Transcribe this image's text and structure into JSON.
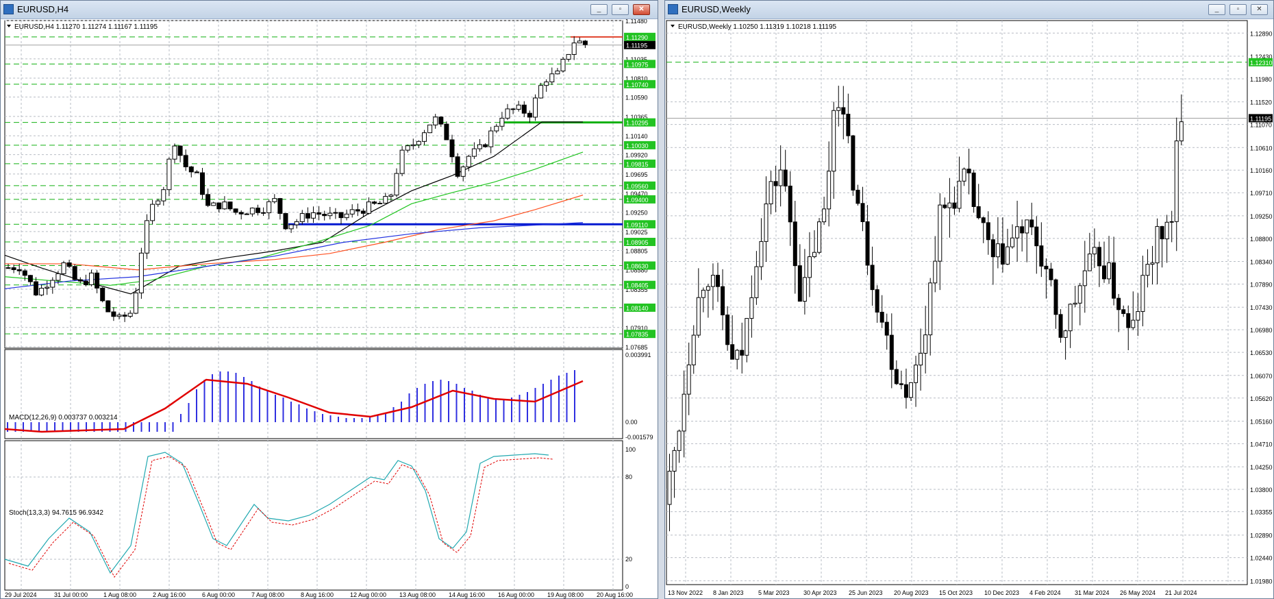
{
  "left_window": {
    "title": "EURUSD,H4",
    "chart_header": "EURUSD,H4  1.11270 1.11274 1.11167 1.11195",
    "price_labels": [
      "1.11480",
      "1.11035",
      "1.10810",
      "1.10590",
      "1.10365",
      "1.10140",
      "1.09920",
      "1.09695",
      "1.09470",
      "1.09250",
      "1.09025",
      "1.08805",
      "1.08580",
      "1.08355",
      "1.07910",
      "1.07685"
    ],
    "level_labels": [
      "1.11290",
      "1.10975",
      "1.10740",
      "1.10295",
      "1.10030",
      "1.09815",
      "1.09560",
      "1.09400",
      "1.09110",
      "1.08905",
      "1.08630",
      "1.08405",
      "1.08140",
      "1.07835"
    ],
    "current_price": "1.11195",
    "time_labels": [
      "29 Jul 2024",
      "31 Jul 00:00",
      "1 Aug 08:00",
      "2 Aug 16:00",
      "6 Aug 00:00",
      "7 Aug 08:00",
      "8 Aug 16:00",
      "12 Aug 00:00",
      "13 Aug 08:00",
      "14 Aug 16:00",
      "16 Aug 00:00",
      "19 Aug 08:00",
      "20 Aug 16:00"
    ],
    "macd": {
      "header": "MACD(12,26,9) 0.003737 0.003214",
      "labels": [
        "0.003991",
        "0.00",
        "-0.001579"
      ]
    },
    "stoch": {
      "header": "Stoch(13,3,3) 94.7615 96.9342",
      "labels": [
        "100",
        "80",
        "20",
        "0"
      ]
    }
  },
  "right_window": {
    "title": "EURUSD,Weekly",
    "chart_header": "EURUSD,Weekly  1.10250 1.11319 1.10218 1.11195",
    "price_labels": [
      "1.12890",
      "1.12430",
      "1.11980",
      "1.11520",
      "1.11070",
      "1.10610",
      "1.10160",
      "1.09710",
      "1.09250",
      "1.08800",
      "1.08340",
      "1.07890",
      "1.07430",
      "1.06980",
      "1.06530",
      "1.06070",
      "1.05620",
      "1.05160",
      "1.04710",
      "1.04250",
      "1.03800",
      "1.03355",
      "1.02890",
      "1.02440",
      "1.01980"
    ],
    "level_label": "1.12310",
    "current_price": "1.11195",
    "time_labels": [
      "13 Nov 2022",
      "8 Jan 2023",
      "5 Mar 2023",
      "30 Apr 2023",
      "25 Jun 2023",
      "20 Aug 2023",
      "15 Oct 2023",
      "10 Dec 2023",
      "4 Feb 2024",
      "31 Mar 2024",
      "26 May 2024",
      "21 Jul 2024"
    ]
  },
  "window_buttons": {
    "minimize": "_",
    "restore": "▫",
    "close": "✕"
  },
  "colors": {
    "grid": "#b7bcc4",
    "level_line": "#10b010",
    "level_badge": "#22c322",
    "resistance": "#e0402a",
    "support": "#0018d0",
    "macd_hist": "#2f2fe0",
    "macd_signal": "#e00000",
    "stoch_main": "#20a8b0",
    "stoch_signal": "#e00000",
    "ma_black": "#000000",
    "ma_green": "#1fc51f",
    "ma_red": "#ff5020",
    "ma_blue": "#2030e0"
  }
}
